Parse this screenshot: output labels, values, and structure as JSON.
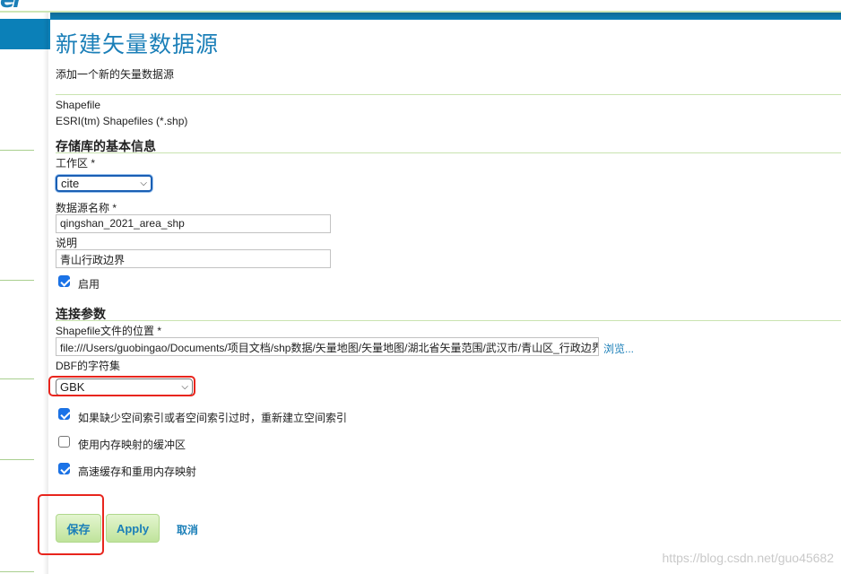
{
  "header": {
    "logo_fragment": "er"
  },
  "page": {
    "title": "新建矢量数据源",
    "subtitle": "添加一个新的矢量数据源"
  },
  "datastore_type": {
    "name": "Shapefile",
    "description": "ESRI(tm) Shapefiles (*.shp)"
  },
  "basic_info": {
    "section_title": "存储库的基本信息",
    "workspace_label": "工作区 *",
    "workspace_value": "cite",
    "name_label": "数据源名称 *",
    "name_value": "qingshan_2021_area_shp",
    "description_label": "说明",
    "description_value": "青山行政边界",
    "enabled_label": "启用",
    "enabled": true
  },
  "connection": {
    "section_title": "连接参数",
    "location_label": "Shapefile文件的位置 *",
    "location_value": "file:///Users/guobingao/Documents/项目文档/shp数据/矢量地图/矢量地图/湖北省矢量范围/武汉市/青山区_行政边界",
    "browse_label": "浏览...",
    "charset_label": "DBF的字符集",
    "charset_value": "GBK",
    "options": [
      {
        "label": "如果缺少空间索引或者空间索引过时，重新建立空间索引",
        "checked": true
      },
      {
        "label": "使用内存映射的缓冲区",
        "checked": false
      },
      {
        "label": "高速缓存和重用内存映射",
        "checked": true
      }
    ]
  },
  "actions": {
    "save_label": "保存",
    "apply_label": "Apply",
    "cancel_label": "取消"
  },
  "watermark": "https://blog.csdn.net/guo45682",
  "colors": {
    "accent": "#1b7fb8",
    "header_bar": "#0b80b8",
    "divider": "#c9e3b0",
    "checkbox": "#1a73e8",
    "highlight": "#e8251d",
    "button": "#bfe39b"
  }
}
